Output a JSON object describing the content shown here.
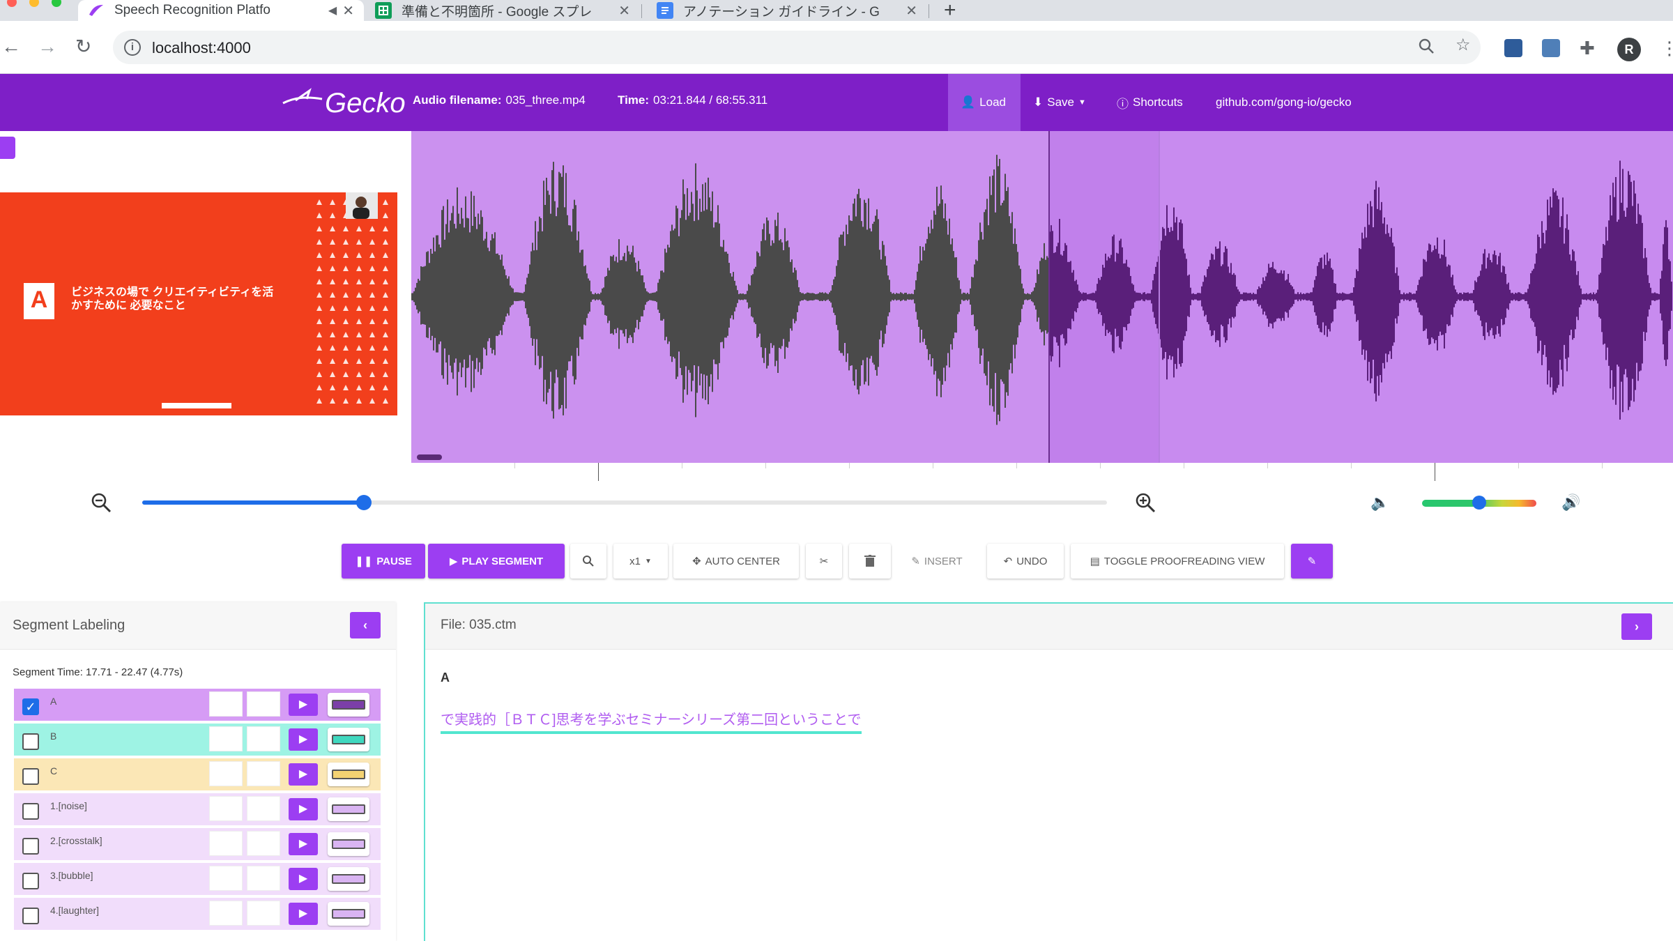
{
  "browser": {
    "tabs": [
      {
        "title": "Speech Recognition Platfo",
        "icon": "gecko-favicon",
        "active": true
      },
      {
        "title": "準備と不明箇所 - Google スプレ",
        "icon": "sheets-favicon",
        "active": false
      },
      {
        "title": "アノテーション ガイドライン - G",
        "icon": "docs-favicon",
        "active": false
      }
    ],
    "url": "localhost:4000",
    "profile_initial": "R"
  },
  "header": {
    "logo": "Gecko",
    "audio_filename_label": "Audio filename:",
    "audio_filename": "035_three.mp4",
    "time_label": "Time:",
    "time_value": "03:21.844 / 68:55.311",
    "nav": {
      "load": "Load",
      "save": "Save",
      "shortcuts": "Shortcuts",
      "github": "github.com/gong-io/gecko"
    }
  },
  "video": {
    "title": "ビジネスの場で クリエイティビティを活かすために 必要なこと",
    "brand_letter": "A"
  },
  "zoom": {
    "level": 0.23
  },
  "volume": {
    "level": 0.5
  },
  "actions": {
    "pause": "PAUSE",
    "play_segment": "PLAY SEGMENT",
    "speed": "x1",
    "auto_center": "AUTO CENTER",
    "insert": "INSERT",
    "undo": "UNDO",
    "toggle_proofreading": "TOGGLE PROOFREADING VIEW"
  },
  "segment_panel": {
    "title": "Segment Labeling",
    "segment_time": "Segment Time: 17.71 - 22.47 (4.77s)",
    "labels": [
      {
        "name": "A",
        "checked": true,
        "row_color": "#d69cf5",
        "swatch": "#7b3fa8"
      },
      {
        "name": "B",
        "checked": false,
        "row_color": "#9ef3e4",
        "swatch": "#3fd8bf"
      },
      {
        "name": "C",
        "checked": false,
        "row_color": "#fbe7b6",
        "swatch": "#f3d272"
      },
      {
        "name": "1.[noise]",
        "checked": false,
        "row_color": "#f1ddfb",
        "swatch": "#d9b4f2"
      },
      {
        "name": "2.[crosstalk]",
        "checked": false,
        "row_color": "#f1ddfb",
        "swatch": "#d9b4f2"
      },
      {
        "name": "3.[bubble]",
        "checked": false,
        "row_color": "#f1ddfb",
        "swatch": "#d9b4f2"
      },
      {
        "name": "4.[laughter]",
        "checked": false,
        "row_color": "#f1ddfb",
        "swatch": "#d9b4f2"
      }
    ]
  },
  "transcript": {
    "file_label": "File: 035.ctm",
    "speaker": "A",
    "text": "で実践的［ＢＴＣ]思考を学ぶセミナーシリーズ第二回ということで"
  },
  "colors": {
    "brand": "#7e1fc7",
    "accent": "#9c3ef2",
    "waveform_bg": "#c88bef",
    "waveform_a": "#4a4a4a",
    "waveform_b": "#5a1f7a",
    "highlight": "#52e6cf"
  }
}
